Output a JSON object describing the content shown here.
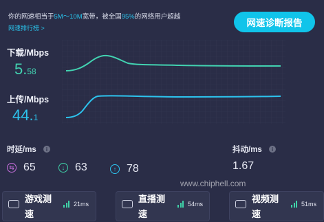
{
  "header": {
    "summary_prefix": "你的网速相当于",
    "summary_band": "5M～10M",
    "summary_mid": "宽带，被全国",
    "summary_pct": "95%",
    "summary_suffix": "的网络用户超越",
    "rank_link": "网速排行榜 >",
    "report_button": "网速诊断报告"
  },
  "download": {
    "label": "下载/Mbps",
    "value_int": "5.",
    "value_dec": "58",
    "color": "#42d3b1"
  },
  "upload": {
    "label": "上传/Mbps",
    "value_int": "44.",
    "value_dec": "1",
    "color": "#2cc3ee"
  },
  "latency": {
    "title": "时延/ms",
    "info": "i",
    "metrics": [
      {
        "icon": "swap-arrows-icon",
        "value": "65",
        "color": "#c86fde"
      },
      {
        "icon": "down-arrow-icon",
        "value": "63",
        "color": "#3fd3a8"
      },
      {
        "icon": "up-arrow-icon",
        "value": "78",
        "color": "#2cc3ee"
      }
    ]
  },
  "jitter": {
    "title": "抖动/ms",
    "info": "i",
    "value": "1.67"
  },
  "cards": [
    {
      "label": "游戏测速",
      "ms": "21ms",
      "icon": "gamepad-icon"
    },
    {
      "label": "直播测速",
      "ms": "54ms",
      "icon": "tv-icon"
    },
    {
      "label": "视频测速",
      "ms": "51ms",
      "icon": "video-play-icon"
    }
  ],
  "watermark": "www.chiphell.com"
}
